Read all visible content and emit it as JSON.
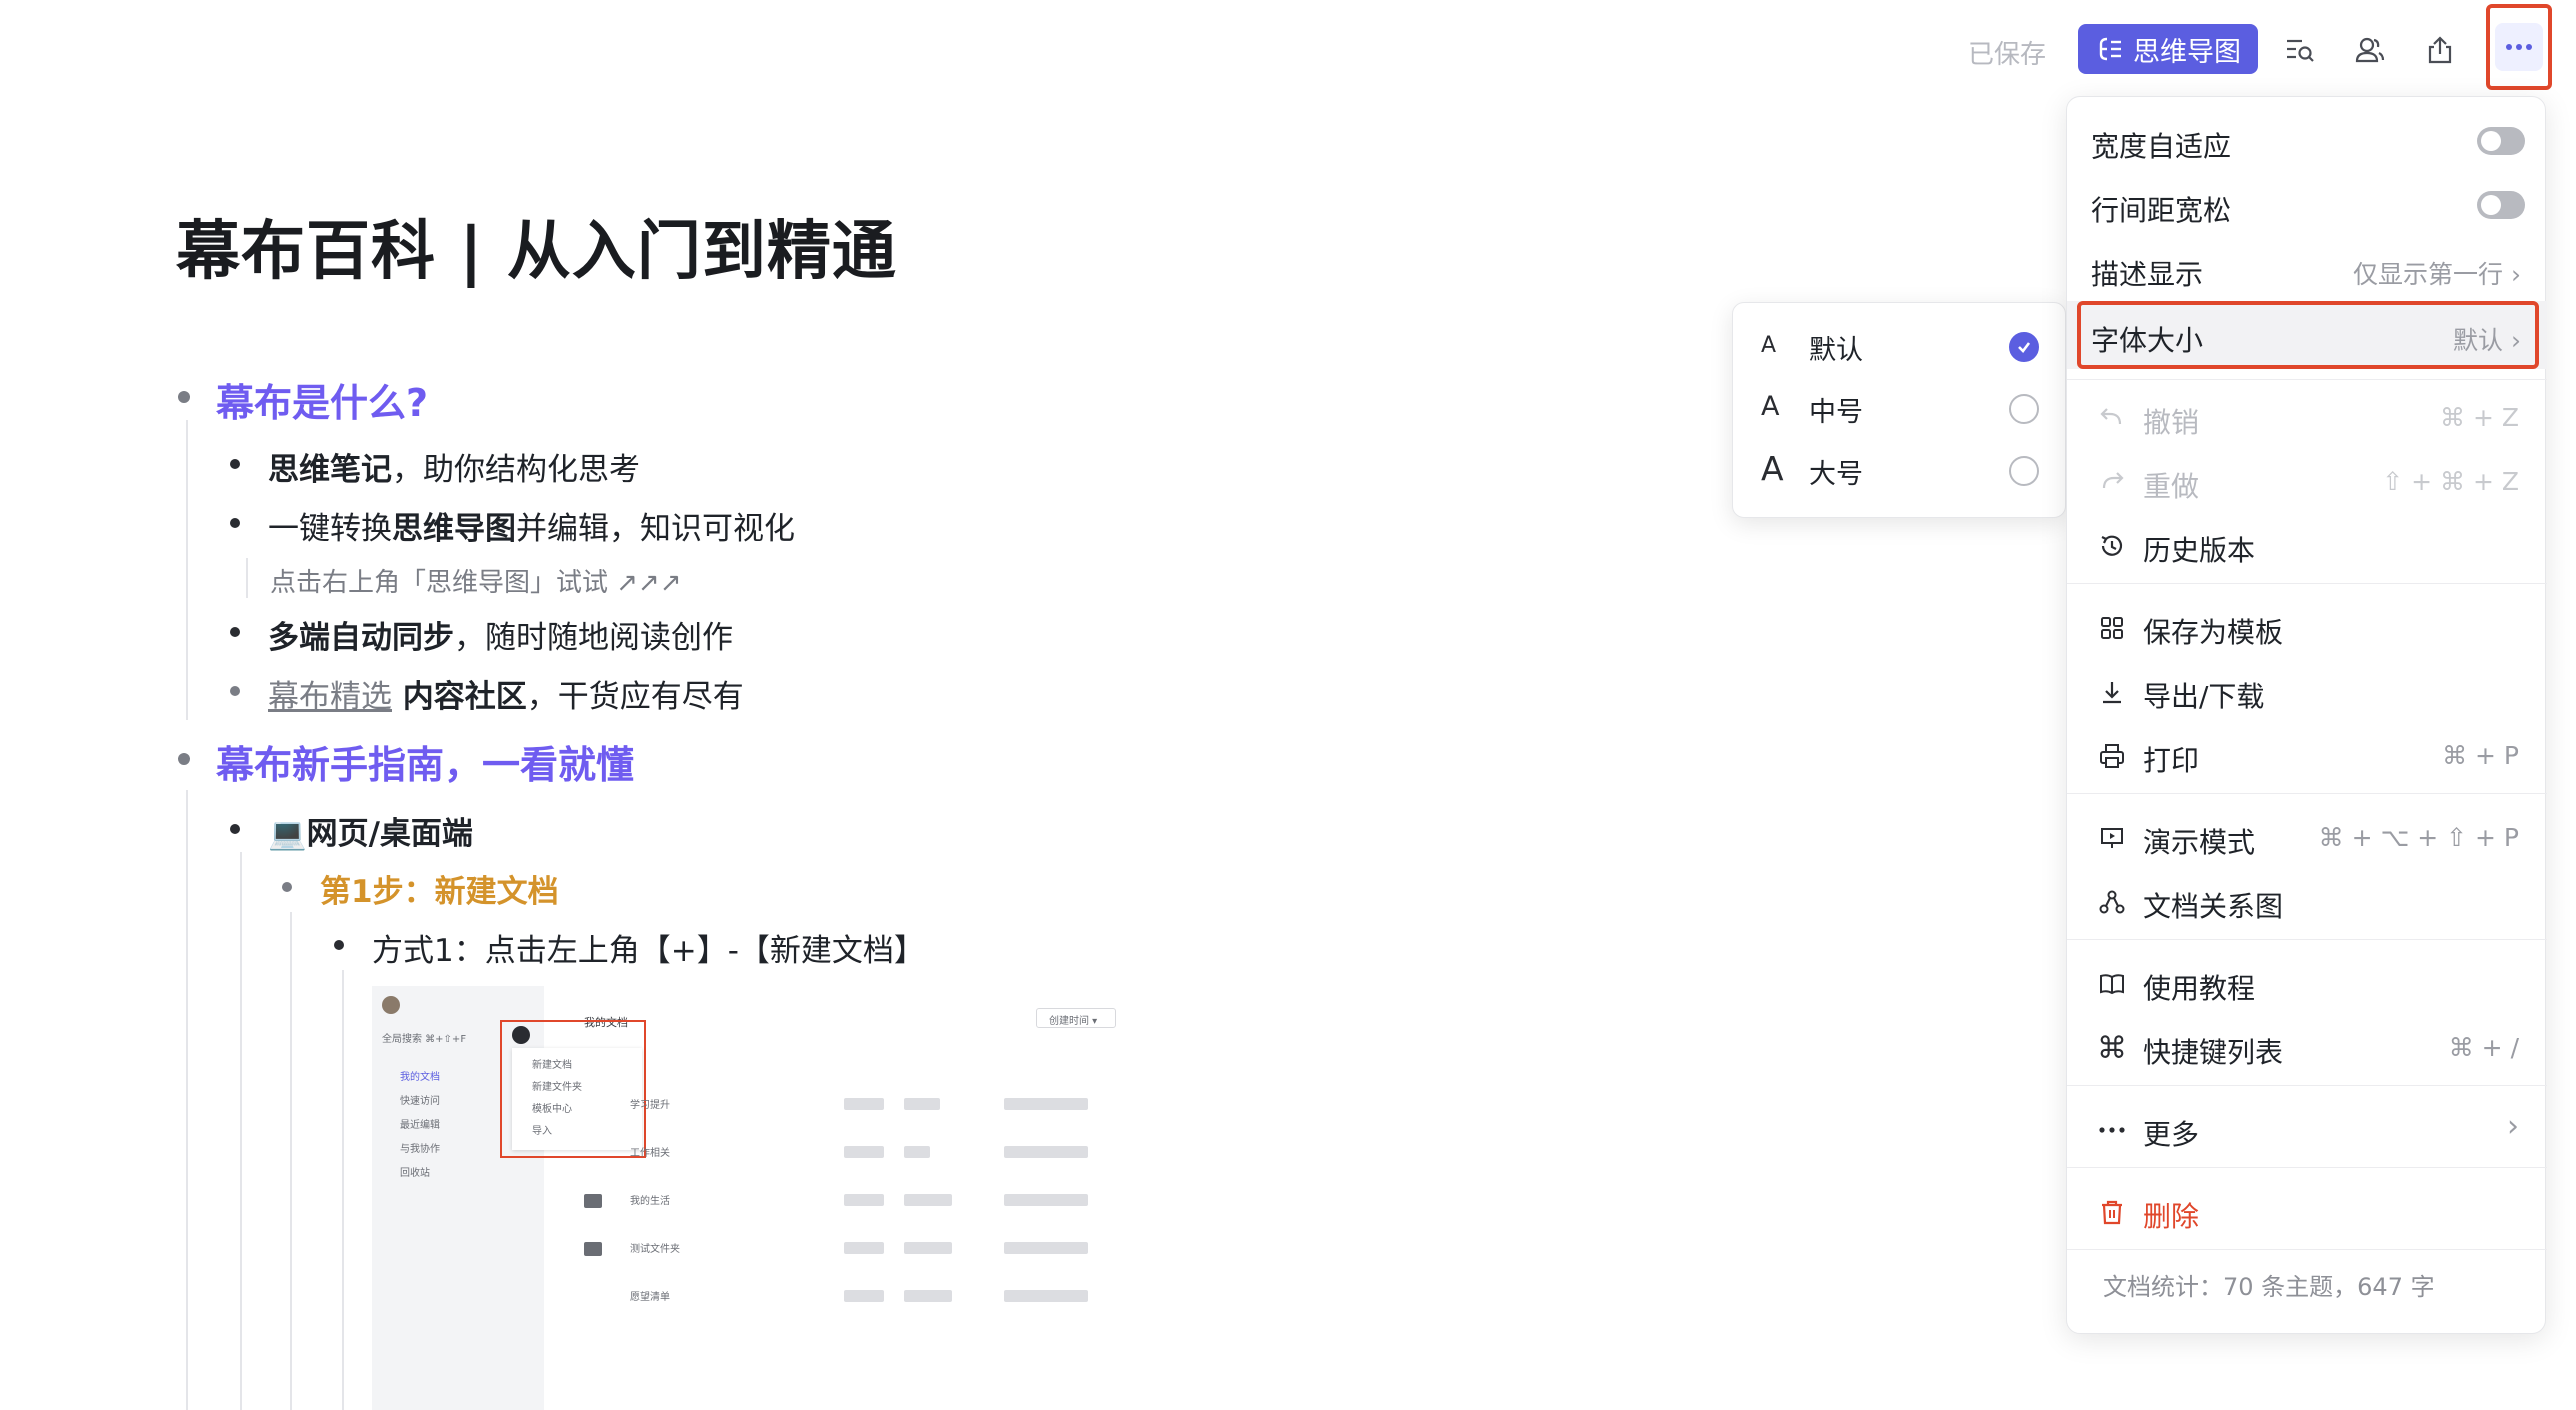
{
  "topbar": {
    "saved_status": "已保存",
    "mindmap_label": "思维导图"
  },
  "doc": {
    "title": "幕布百科 | 从入门到精通",
    "s1_heading": "幕布是什么?",
    "s1_i1_bold": "思维笔记",
    "s1_i1_rest": "，助你结构化思考",
    "s1_i2_pre": "一键转换",
    "s1_i2_bold": "思维导图",
    "s1_i2_rest": "并编辑，知识可视化",
    "s1_note": "点击右上角「思维导图」试试 ↗↗↗",
    "s1_i3_bold": "多端自动同步",
    "s1_i3_rest": "，随时随地阅读创作",
    "s1_i4_link": "幕布精选",
    "s1_i4_bold": " 内容社区",
    "s1_i4_rest": "，干货应有尽有",
    "s2_heading": "幕布新手指南，一看就懂",
    "s2_i1": "💻网页/桌面端",
    "step1": "第1步：新建文档",
    "method1": "方式1：点击左上角【+】-【新建文档】"
  },
  "thumbnail": {
    "title": "我的文档",
    "menu_items": [
      "新建文档",
      "新建文件夹",
      "模板中心",
      "导入"
    ],
    "side_items": [
      "我的文档",
      "快速访问",
      "最近编辑",
      "与我协作",
      "回收站"
    ],
    "rows": [
      "学习提升",
      "工作相关",
      "我的生活",
      "测试文件夹",
      "愿望清单"
    ],
    "search_placeholder": "全局搜索 ⌘+⇧+F",
    "sort_label": "创建时间 ▾"
  },
  "submenu": {
    "items": [
      {
        "label": "默认",
        "checked": true
      },
      {
        "label": "中号",
        "checked": false
      },
      {
        "label": "大号",
        "checked": false
      }
    ]
  },
  "menu": {
    "width_adapt": "宽度自适应",
    "line_spacing": "行间距宽松",
    "desc_display": "描述显示",
    "desc_display_value": "仅显示第一行",
    "font_size": "字体大小",
    "font_size_value": "默认",
    "undo": "撤销",
    "undo_sc": "⌘ + Z",
    "redo": "重做",
    "redo_sc": "⇧ + ⌘ + Z",
    "history": "历史版本",
    "save_template": "保存为模板",
    "export": "导出/下载",
    "print": "打印",
    "print_sc": "⌘ + P",
    "present": "演示模式",
    "present_sc": "⌘ + ⌥ + ⇧ + P",
    "relation": "文档关系图",
    "tutorial": "使用教程",
    "shortcuts": "快捷键列表",
    "shortcuts_sc": "⌘ + /",
    "more": "更多",
    "delete": "删除",
    "stats": "文档统计：70 条主题，647 字"
  },
  "colors": {
    "accent": "#5b5ee0",
    "heading": "#6f5cf0",
    "step": "#d4932b",
    "danger": "#e0472b"
  }
}
